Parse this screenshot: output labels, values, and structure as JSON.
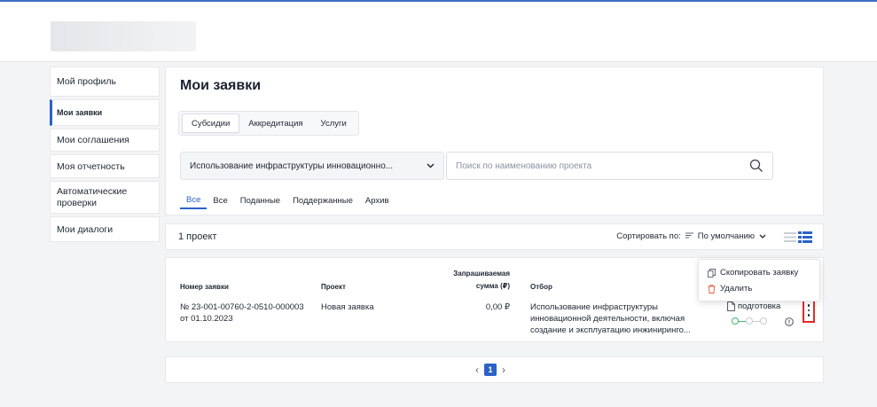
{
  "sidebar": {
    "items": [
      {
        "label": "Мой профиль"
      },
      {
        "label": "Мои заявки"
      },
      {
        "label": "Мои соглашения"
      },
      {
        "label": "Моя отчетность"
      },
      {
        "label": "Автоматические проверки"
      },
      {
        "label": "Мои диалоги"
      }
    ],
    "active_index": 1
  },
  "main": {
    "title": "Мои заявки",
    "tabs": [
      {
        "label": "Субсидии"
      },
      {
        "label": "Аккредитация"
      },
      {
        "label": "Услуги"
      }
    ],
    "selected_tab": "Субсидии",
    "selection_label": "Использование инфраструктуры инновационно...",
    "search_placeholder": "Поиск по наименованию проекта",
    "sub_tabs": [
      {
        "label": "Все"
      },
      {
        "label": "Все"
      },
      {
        "label": "Поданные"
      },
      {
        "label": "Поддержанные"
      },
      {
        "label": "Архив"
      }
    ]
  },
  "list_header": {
    "count_text": "1 проект",
    "sort_label": "Сортировать по:",
    "sort_value": "По умолчанию"
  },
  "table": {
    "columns": {
      "number": "Номер заявки",
      "project": "Проект",
      "amount_line1": "Запрашиваемая",
      "amount_line2": "сумма (₽)",
      "selection": "Отбор"
    },
    "rows": [
      {
        "number_line1": "№ 23-001-00760-2-0510-000003",
        "number_line2": "от 01.10.2023",
        "project": "Новая заявка",
        "amount": "0,00 ₽",
        "selection_line1": "Использование инфраструктуры",
        "selection_line2": "инновационной деятельности, включая",
        "selection_line3": "создание и эксплуатацию инжиниринго...",
        "status": "подготовка",
        "progress_done_steps": 1,
        "progress_total_steps": 3
      }
    ]
  },
  "context_menu": {
    "copy_label": "Скопировать заявку",
    "delete_label": "Удалить"
  },
  "pagination": {
    "current_page": "1"
  },
  "colors": {
    "accent": "#2b62c6",
    "highlight_border": "#e02b2b",
    "progress_done": "#40b36a",
    "delete": "#e05a3a"
  }
}
